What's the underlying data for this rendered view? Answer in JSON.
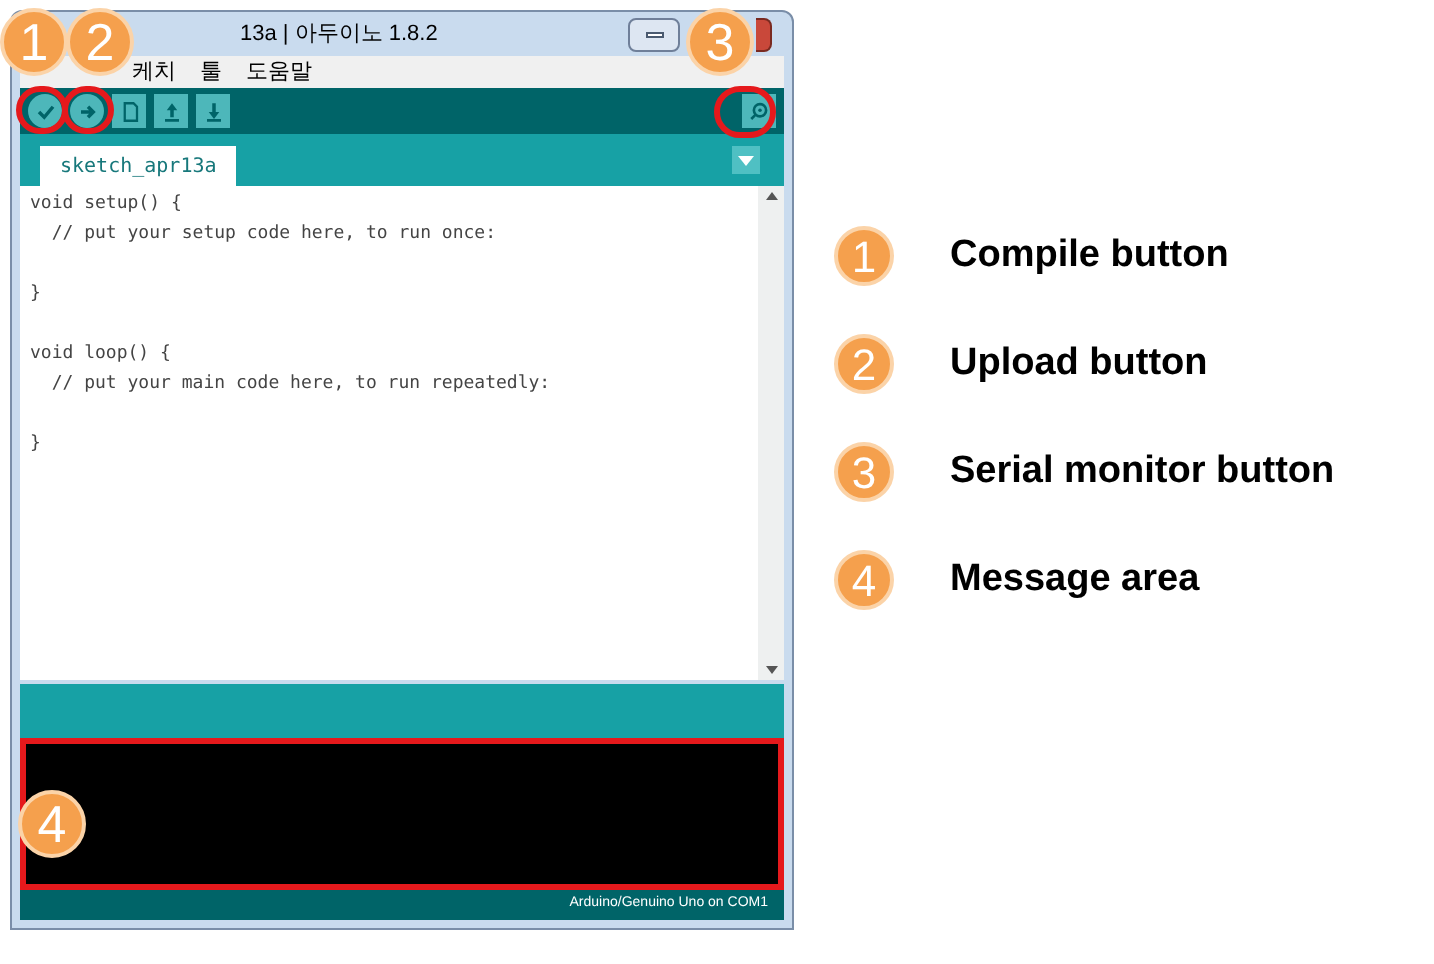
{
  "window": {
    "title": "13a | 아두이노 1.8.2"
  },
  "menu": [
    "케치",
    "툴",
    "도움말"
  ],
  "toolbar": [
    {
      "kind": "verify"
    },
    {
      "kind": "upload"
    },
    {
      "kind": "new"
    },
    {
      "kind": "open"
    },
    {
      "kind": "save"
    },
    {
      "kind": "serial"
    }
  ],
  "tabs": [
    {
      "label": "sketch_apr13a",
      "selected": true
    }
  ],
  "code_blocks": [
    [
      "void setup() {",
      "  // put your setup code here, to run once:"
    ],
    [
      "}"
    ],
    [
      "void loop() {",
      "  // put your main code here, to run repeatedly:"
    ],
    [
      "}"
    ]
  ],
  "status_bar": "Arduino/Genuino Uno on COM1",
  "callouts": [
    {
      "number": "1"
    },
    {
      "number": "2"
    },
    {
      "number": "3"
    },
    {
      "number": "4"
    }
  ],
  "legend": [
    {
      "number": "1",
      "label": "Compile button"
    },
    {
      "number": "2",
      "label": "Upload button"
    },
    {
      "number": "3",
      "label": "Serial monitor button"
    },
    {
      "number": "4",
      "label": "Message area"
    }
  ]
}
